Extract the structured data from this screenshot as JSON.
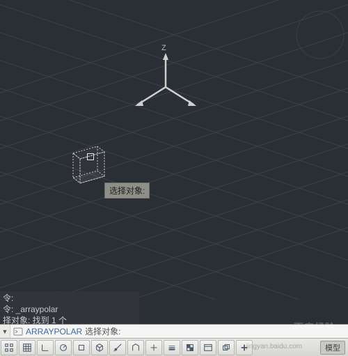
{
  "axis": {
    "z_label": "Z"
  },
  "tooltip": {
    "select_objects": "选择对象:"
  },
  "command_history": {
    "line1": "令:",
    "line2": "令: _arraypolar",
    "line3": "择对象: 找到 1 个"
  },
  "command_line": {
    "keyword": "ARRAYPOLAR",
    "prompt": "选择对象:"
  },
  "status": {
    "workspace_tab": "模型"
  },
  "watermark": {
    "brand": "百度经验",
    "url": "jingyan.baidu.com"
  }
}
